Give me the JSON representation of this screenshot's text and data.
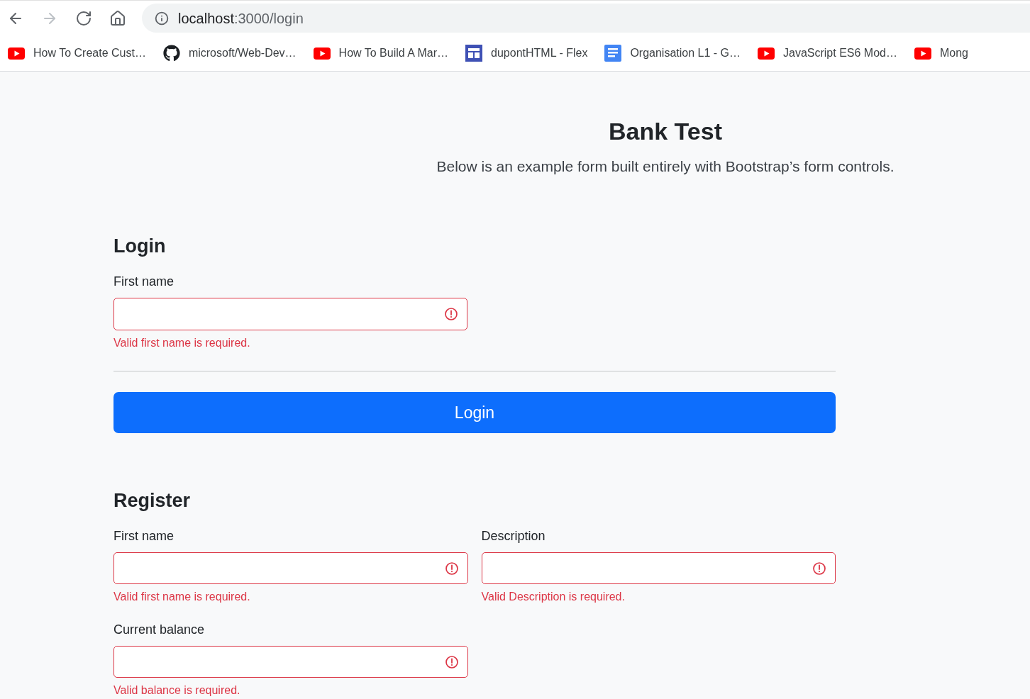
{
  "browser": {
    "nav_buttons": [
      {
        "kind": "back",
        "disabled": false
      },
      {
        "kind": "forward",
        "disabled": true
      },
      {
        "kind": "reload",
        "disabled": false
      },
      {
        "kind": "home",
        "disabled": false
      }
    ],
    "address": {
      "host": "localhost",
      "path": ":3000/login"
    },
    "bookmarks": [
      {
        "kind": "video",
        "label": "How To Create Cust…"
      },
      {
        "kind": "repo",
        "label": "microsoft/Web-Dev…"
      },
      {
        "kind": "video",
        "label": "How To Build A Mar…"
      },
      {
        "kind": "layout",
        "label": "dupontHTML - Flex"
      },
      {
        "kind": "doc",
        "label": "Organisation L1 - G…"
      },
      {
        "kind": "video",
        "label": "JavaScript ES6 Mod…"
      },
      {
        "kind": "video",
        "label": "Mong"
      }
    ]
  },
  "header": {
    "title": "Bank Test",
    "lead": "Below is an example form built entirely with Bootstrap’s form controls."
  },
  "login": {
    "heading": "Login",
    "fields": [
      {
        "label": "First name",
        "invalid": true,
        "error": "Valid first name is required."
      }
    ],
    "button": "Login"
  },
  "register": {
    "heading": "Register",
    "fields": [
      {
        "label": "First name",
        "invalid": true,
        "error": "Valid first name is required."
      },
      {
        "label": "Description",
        "invalid": true,
        "error": "Valid Description is required."
      },
      {
        "label": "Current balance",
        "invalid": true,
        "error": "Valid balance is required."
      }
    ]
  }
}
